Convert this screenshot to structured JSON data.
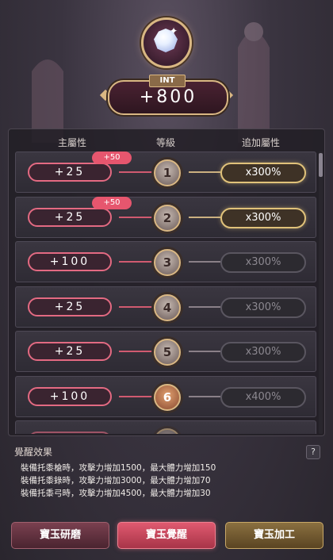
{
  "stat": {
    "tag": "INT",
    "value": "+800"
  },
  "table": {
    "headers": {
      "main": "主屬性",
      "level": "等級",
      "bonus": "追加屬性"
    },
    "rows": [
      {
        "main": "+25",
        "bonus_tag": "+50",
        "level": "1",
        "add": "x300%",
        "active": true
      },
      {
        "main": "+25",
        "bonus_tag": "+50",
        "level": "2",
        "add": "x300%",
        "active": true
      },
      {
        "main": "+100",
        "bonus_tag": "",
        "level": "3",
        "add": "x300%",
        "active": false
      },
      {
        "main": "+25",
        "bonus_tag": "",
        "level": "4",
        "add": "x300%",
        "active": false
      },
      {
        "main": "+25",
        "bonus_tag": "",
        "level": "5",
        "add": "x300%",
        "active": false
      },
      {
        "main": "+100",
        "bonus_tag": "",
        "level": "6",
        "add": "x400%",
        "active": false
      }
    ]
  },
  "effect": {
    "title": "覺醒效果",
    "help": "?",
    "lines": [
      "裝備托黍槍時，攻擊力增加1500，最大體力增加150",
      "裝備托黍錄時，攻擊力增加3000，最大體力增加70",
      "裝備托黍弓時，攻擊力增加4500，最大體力增加30"
    ]
  },
  "buttons": {
    "polish": "寶玉研磨",
    "awaken": "寶玉覺醒",
    "craft": "寶玉加工"
  },
  "colors": {
    "accent": "#e6566e",
    "gold": "#d9b783"
  }
}
